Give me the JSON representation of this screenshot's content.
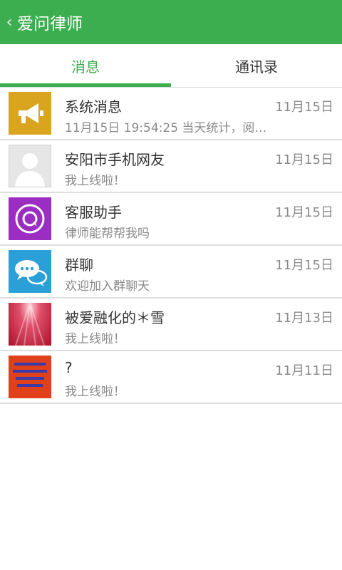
{
  "header": {
    "back_icon": "chevron-left-icon",
    "title": "爱问律师",
    "color": "#3dae4f"
  },
  "tabs": [
    {
      "label": "消息",
      "active": true
    },
    {
      "label": "通讯录",
      "active": false
    }
  ],
  "conversations": [
    {
      "name": "系统消息",
      "time": "11月15日",
      "preview": "11月15日 19:54:25 当天统计，阅…",
      "avatar": "megaphone-icon",
      "avatar_color": "#d9a51e"
    },
    {
      "name": "安阳市手机网友",
      "time": "11月15日",
      "preview": "我上线啦！",
      "avatar": "default-user-avatar",
      "avatar_color": "#e6e6e6"
    },
    {
      "name": "客服助手",
      "time": "11月15日",
      "preview": "律师能帮帮我吗",
      "avatar": "support-chat-icon",
      "avatar_color": "#9b2dc3"
    },
    {
      "name": "群聊",
      "time": "11月15日",
      "preview": "欢迎加入群聊天",
      "avatar": "group-chat-icon",
      "avatar_color": "#2a9fd8"
    },
    {
      "name": "被爱融化的＊雪",
      "time": "11月13日",
      "preview": "我上线啦！",
      "avatar": "red-curtain-photo",
      "avatar_color": "#c0213c"
    },
    {
      "name": "?",
      "time": "11月11日",
      "preview": "我上线啦！",
      "avatar": "text-image-avatar",
      "avatar_color": "#e0401a"
    }
  ]
}
